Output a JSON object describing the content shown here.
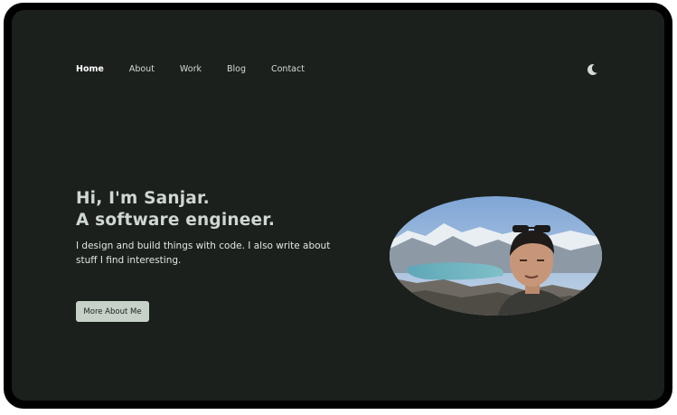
{
  "nav": {
    "items": [
      {
        "label": "Home",
        "active": true
      },
      {
        "label": "About",
        "active": false
      },
      {
        "label": "Work",
        "active": false
      },
      {
        "label": "Blog",
        "active": false
      },
      {
        "label": "Contact",
        "active": false
      }
    ],
    "theme_icon": "moon-icon"
  },
  "hero": {
    "title_line1": "Hi, I'm Sanjar.",
    "title_line2": "A software engineer.",
    "description": "I design and build things with code. I also write about stuff I find interesting.",
    "cta_label": "More About Me"
  },
  "colors": {
    "background": "#1b201d",
    "heading": "#cfd7d1",
    "button_bg": "#c6d1c8"
  }
}
